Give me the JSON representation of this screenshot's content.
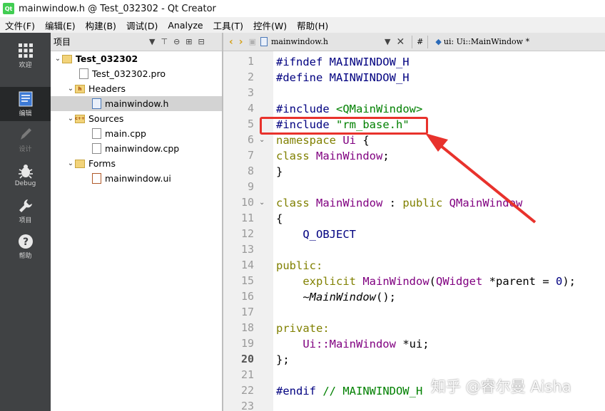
{
  "window": {
    "app_icon_text": "Qt",
    "title": "mainwindow.h @ Test_032302 - Qt Creator"
  },
  "menu": [
    "文件(F)",
    "编辑(E)",
    "构建(B)",
    "调试(D)",
    "Analyze",
    "工具(T)",
    "控件(W)",
    "帮助(H)"
  ],
  "modes": [
    {
      "label": "欢迎",
      "icon": "grid-icon",
      "state": "normal"
    },
    {
      "label": "编辑",
      "icon": "edit-doc-icon",
      "state": "active"
    },
    {
      "label": "设计",
      "icon": "pencil-icon",
      "state": "disabled"
    },
    {
      "label": "Debug",
      "icon": "bug-icon",
      "state": "normal"
    },
    {
      "label": "项目",
      "icon": "wrench-icon",
      "state": "normal"
    },
    {
      "label": "帮助",
      "icon": "help-icon",
      "state": "normal"
    }
  ],
  "projects_panel": {
    "title": "项目",
    "tree": [
      {
        "label": "Test_032302",
        "kind": "project",
        "depth": 0,
        "expanded": true
      },
      {
        "label": "Test_032302.pro",
        "kind": "pro-file",
        "depth": 1
      },
      {
        "label": "Headers",
        "kind": "folder",
        "folder_badge": "h",
        "depth": 1,
        "expanded": true
      },
      {
        "label": "mainwindow.h",
        "kind": "header-file",
        "depth": 2,
        "selected": true
      },
      {
        "label": "Sources",
        "kind": "folder",
        "folder_badge": "c++",
        "depth": 1,
        "expanded": true
      },
      {
        "label": "main.cpp",
        "kind": "cpp-file",
        "depth": 2
      },
      {
        "label": "mainwindow.cpp",
        "kind": "cpp-file",
        "depth": 2
      },
      {
        "label": "Forms",
        "kind": "folder",
        "folder_badge": "",
        "depth": 1,
        "expanded": true
      },
      {
        "label": "mainwindow.ui",
        "kind": "ui-file",
        "depth": 2
      }
    ]
  },
  "editor": {
    "open_file": "mainwindow.h",
    "hash_label": "#",
    "symbol": "ui: Ui::MainWindow *",
    "current_line": 20,
    "line_numbers": [
      "1",
      "2",
      "3",
      "4",
      "5",
      "6",
      "7",
      "8",
      "9",
      "10",
      "11",
      "12",
      "13",
      "14",
      "15",
      "16",
      "17",
      "18",
      "19",
      "20",
      "21",
      "22",
      "23"
    ],
    "code_lines": [
      "#ifndef MAINWINDOW_H",
      "#define MAINWINDOW_H",
      "",
      "#include <QMainWindow>",
      "#include \"rm_base.h\"",
      "namespace Ui {",
      "class MainWindow;",
      "}",
      "",
      "class MainWindow : public QMainWindow",
      "{",
      "    Q_OBJECT",
      "",
      "public:",
      "    explicit MainWindow(QWidget *parent = 0);",
      "    ~MainWindow();",
      "",
      "private:",
      "    Ui::MainWindow *ui;",
      "};",
      "",
      "#endif // MAINWINDOW_H",
      ""
    ]
  },
  "annotation": {
    "color": "#e8322c"
  },
  "watermark": "知乎 @睿尔曼 Aisha"
}
